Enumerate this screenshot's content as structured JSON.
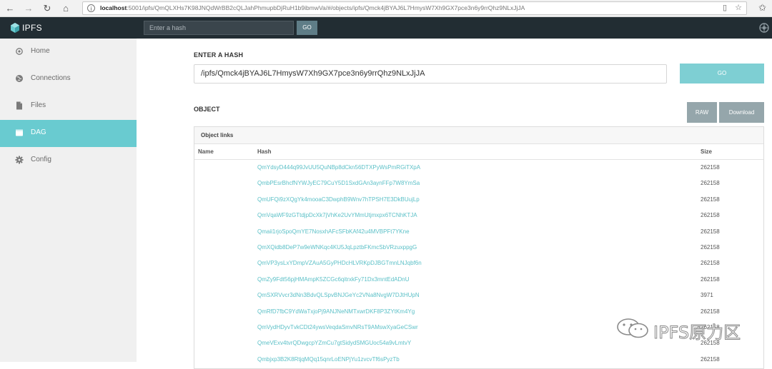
{
  "browser": {
    "back_icon": "←",
    "forward_icon": "→",
    "reload_icon": "↻",
    "home_icon": "⌂",
    "url_host": "localhost",
    "url_rest": ":5001/ipfs/QmQLXHs7K98JNQdWrBB2cQLJahPhmupbDjRuH1b9ibmwVa/#/objects/ipfs/Qmck4jBYAJ6L7HmysW7Xh9GX7pce3n6y9rrQhz9NLxJjJA"
  },
  "header": {
    "logo_text": "IPFS",
    "search_placeholder": "Enter a hash",
    "go_label": "GO"
  },
  "sidebar": {
    "items": [
      {
        "label": "Home",
        "icon": "home-icon"
      },
      {
        "label": "Connections",
        "icon": "globe-icon"
      },
      {
        "label": "Files",
        "icon": "file-icon"
      },
      {
        "label": "DAG",
        "icon": "dag-icon",
        "active": true
      },
      {
        "label": "Config",
        "icon": "gear-icon"
      }
    ]
  },
  "main": {
    "enter_hash_title": "ENTER A HASH",
    "hash_value": "/ipfs/Qmck4jBYAJ6L7HmysW7Xh9GX7pce3n6y9rrQhz9NLxJjJA",
    "go_label": "GO",
    "object_title": "OBJECT",
    "raw_label": "RAW",
    "download_label": "Download",
    "links_title": "Object links",
    "columns": {
      "name": "Name",
      "hash": "Hash",
      "size": "Size"
    },
    "rows": [
      {
        "name": "",
        "hash": "QmYdsyD444q99JvUU5QuNBp8dCkn56DTXPyWsPmRGiTXpA",
        "size": "262158"
      },
      {
        "name": "",
        "hash": "QmbPEsrBhcfNYWJyEC79CuY5D1SxdGAn3aynFFp7W8YmSa",
        "size": "262158"
      },
      {
        "name": "",
        "hash": "QmUFQi9zXQgYk4mooaC3DwphB9Wnv7hTPSH7E3DkBUujLp",
        "size": "262158"
      },
      {
        "name": "",
        "hash": "QmVqaWF9zGTtdjpDcXk7jVhKe2UvYMmUtjmxpx6TCNhKTJA",
        "size": "262158"
      },
      {
        "name": "",
        "hash": "Qmaii1rjoSpoQmYE7NosxhAFcSFbKAf42u4MVBPFt7YKne",
        "size": "262158"
      },
      {
        "name": "",
        "hash": "QmXQidb8DeP7w9eWNKqc4KU5JqLpztbFKmcSbVRzuxppgG",
        "size": "262158"
      },
      {
        "name": "",
        "hash": "QmVP3ysLxYDmpVZAuA5GyPHDcHLVRKpDJBGTmnLNJqbf6n",
        "size": "262158"
      },
      {
        "name": "",
        "hash": "QmZy9Fdt56pjHMAmpK5ZCGc6qitrxkFy71Dx3mntEdADnU",
        "size": "262158"
      },
      {
        "name": "",
        "hash": "QmSXRVvcr3dNn3BdvQLSpvBNJGeYc2VNa8NvgW7DJtHUpN",
        "size": "3971"
      },
      {
        "name": "",
        "hash": "QmRfD7fbC9YdWaTxjoPj9ANJNeNMTxwrDKF8P3ZYtKm4Yg",
        "size": "262158"
      },
      {
        "name": "",
        "hash": "QmVydHDyvTvkCDt24ywsVeqdaSmvNRsT9AMswXyaGeCSwr",
        "size": "262158"
      },
      {
        "name": "",
        "hash": "QmeVExv4tvrQDwgcpYZmCu7gtSidydSMGUoc54a9vLmtvY",
        "size": "262158"
      },
      {
        "name": "",
        "hash": "Qmbjxp3B2K8RtjqMQq15qnrLoENPjYu1zvcvTf6sPyzTb",
        "size": "262158"
      }
    ]
  },
  "watermark": {
    "text": "IPFS原力区"
  }
}
